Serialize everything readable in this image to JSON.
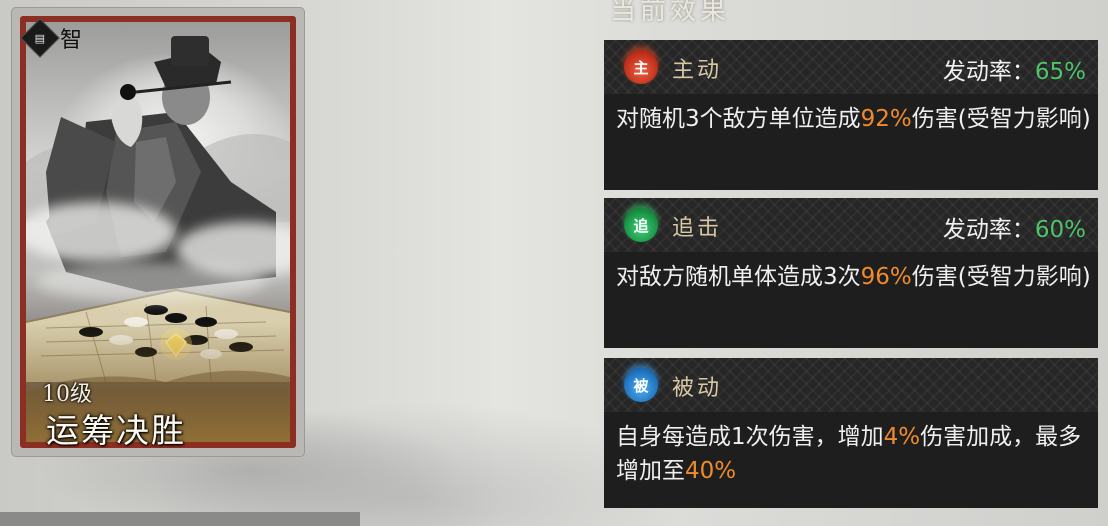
{
  "card": {
    "type_badge": "智",
    "level": "10级",
    "name": "运筹决胜"
  },
  "panel": {
    "title": "当前效果",
    "rate_label": "发动率：",
    "effects": [
      {
        "icon_char": "主",
        "icon_color": "#c9341f",
        "type": "主动",
        "rate": "65%",
        "desc": [
          {
            "t": "对随机3个敌方单位造成"
          },
          {
            "t": "92%",
            "hl": true
          },
          {
            "t": "伤害(受智力影响)"
          }
        ]
      },
      {
        "icon_char": "追",
        "icon_color": "#1f9a4a",
        "type": "追击",
        "rate": "60%",
        "desc": [
          {
            "t": "对敌方随机单体造成3次"
          },
          {
            "t": "96%",
            "hl": true
          },
          {
            "t": "伤害(受智力影响)"
          }
        ]
      },
      {
        "icon_char": "被",
        "icon_color": "#2277c4",
        "type": "被动",
        "rate": "",
        "desc": [
          {
            "t": "自身每造成1次伤害，增加"
          },
          {
            "t": "4%",
            "hl": true
          },
          {
            "t": "伤害加成，最多增加至"
          },
          {
            "t": "40%",
            "hl": true
          }
        ]
      }
    ]
  },
  "colors": {
    "highlight": "#f08a2c",
    "rate_value": "#4ec46a",
    "card_border": "#8d2e22"
  }
}
